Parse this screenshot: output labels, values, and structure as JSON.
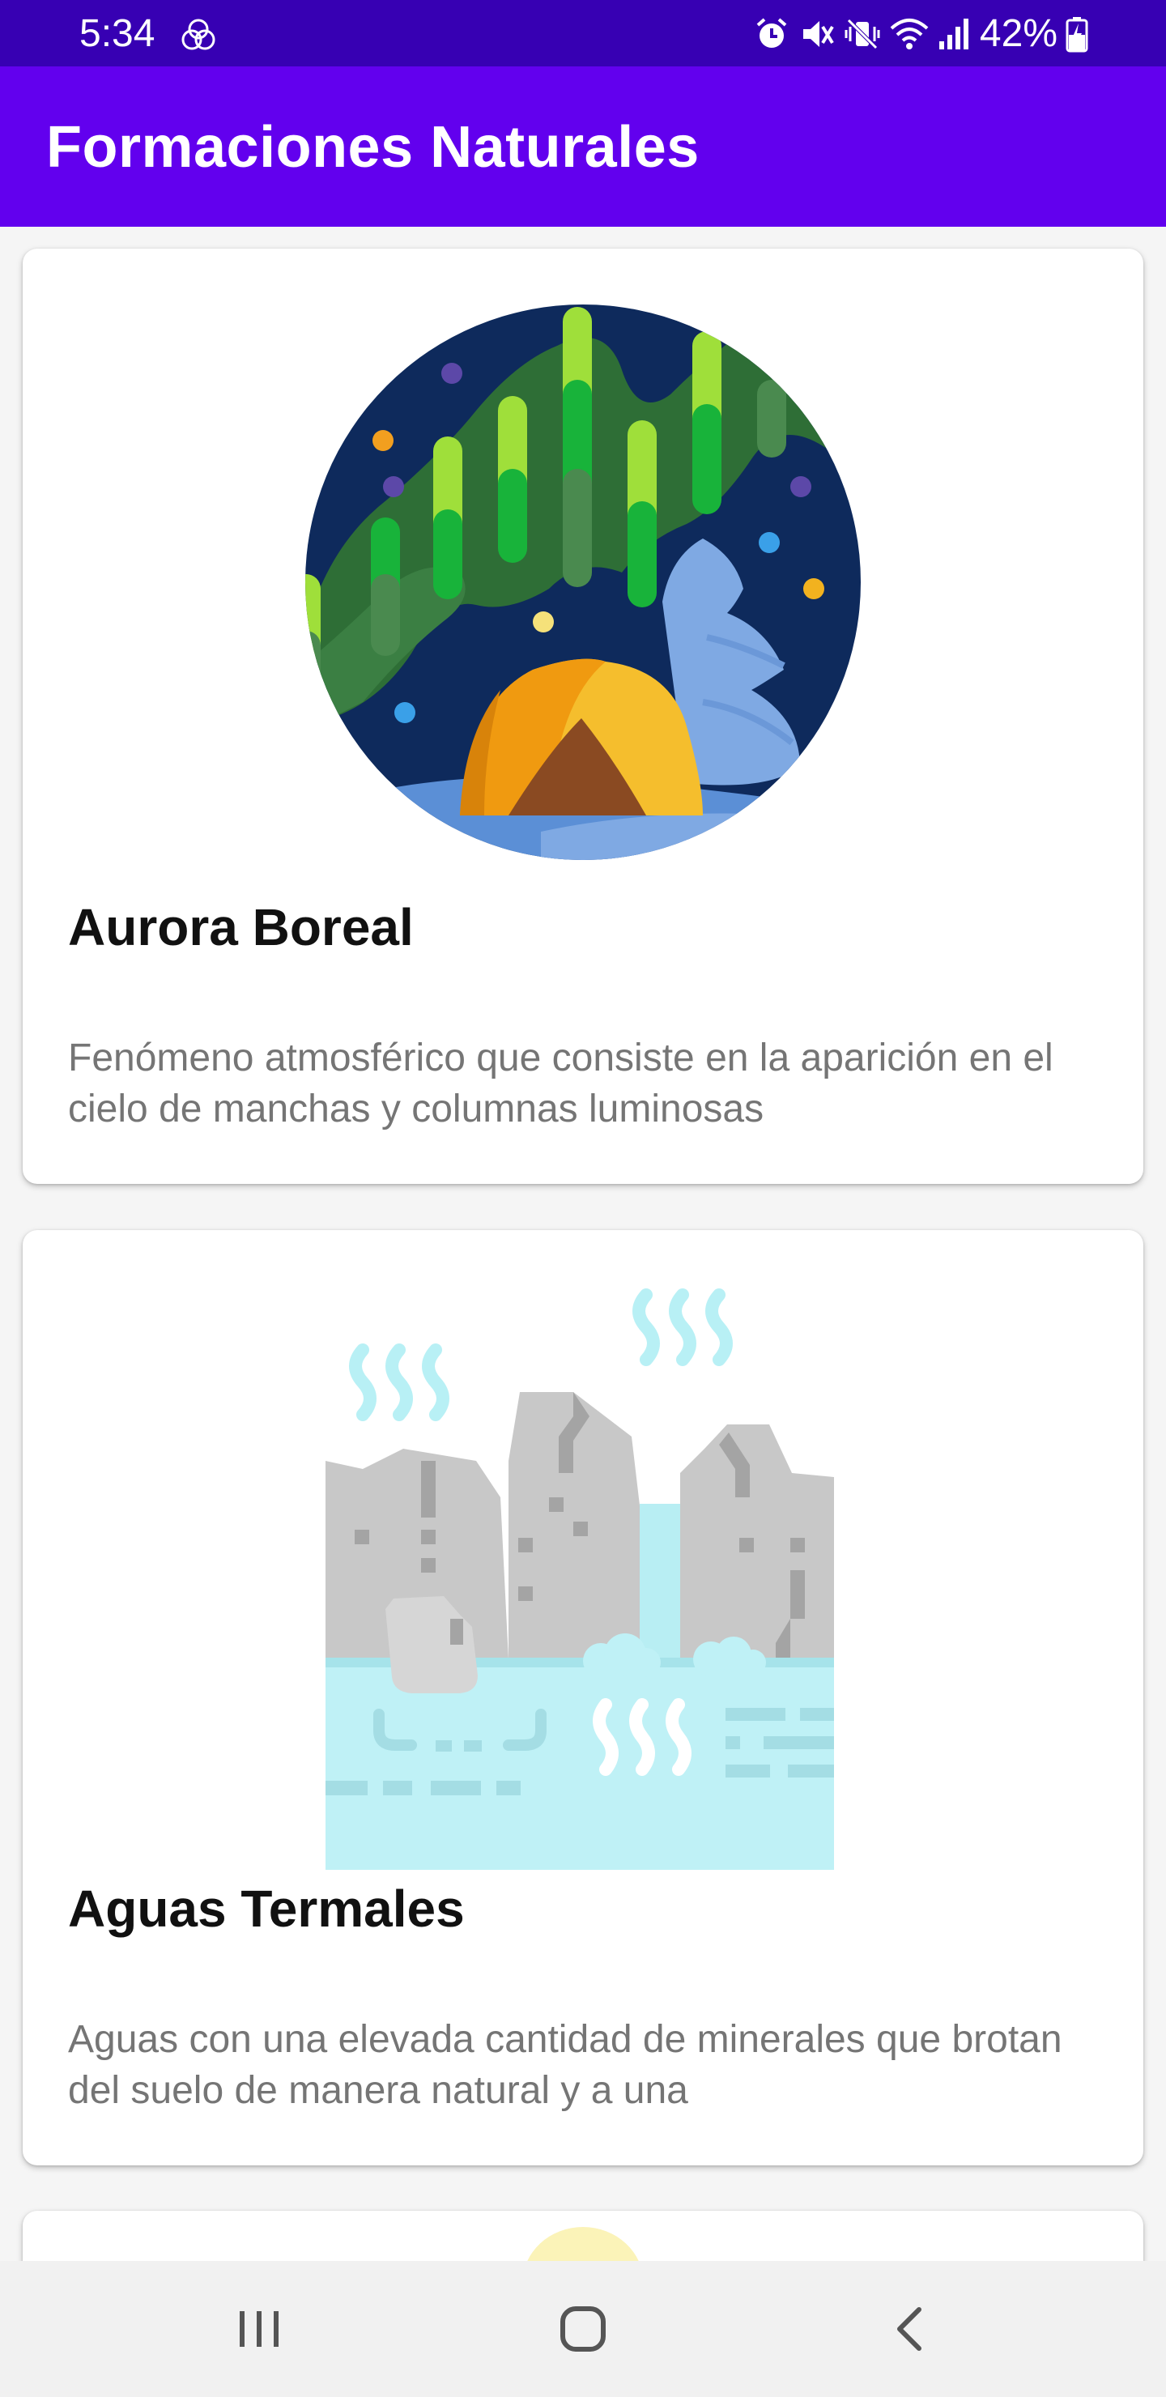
{
  "status_bar": {
    "time": "5:34",
    "battery": "42%",
    "icons": [
      "chrome-icon",
      "alarm-icon",
      "mute-icon",
      "vibrate-icon",
      "wifi-icon",
      "signal-icon",
      "battery-charging-icon"
    ]
  },
  "app_bar": {
    "title": "Formaciones Naturales",
    "color": "#6200ee",
    "status_color": "#3700b3"
  },
  "cards": [
    {
      "title": "Aurora Boreal",
      "description": "Fenómeno atmosférico que consiste en la aparición en el cielo de manchas y columnas luminosas",
      "image": "aurora-camp-illustration"
    },
    {
      "title": "Aguas Termales",
      "description": "Aguas con una elevada cantidad de minerales que brotan del suelo de manera natural y a una",
      "image": "hot-springs-illustration"
    },
    {
      "image": "sun-illustration-partial"
    }
  ],
  "nav_bar": {
    "icons": [
      "recent-apps-icon",
      "home-icon",
      "back-icon"
    ]
  }
}
